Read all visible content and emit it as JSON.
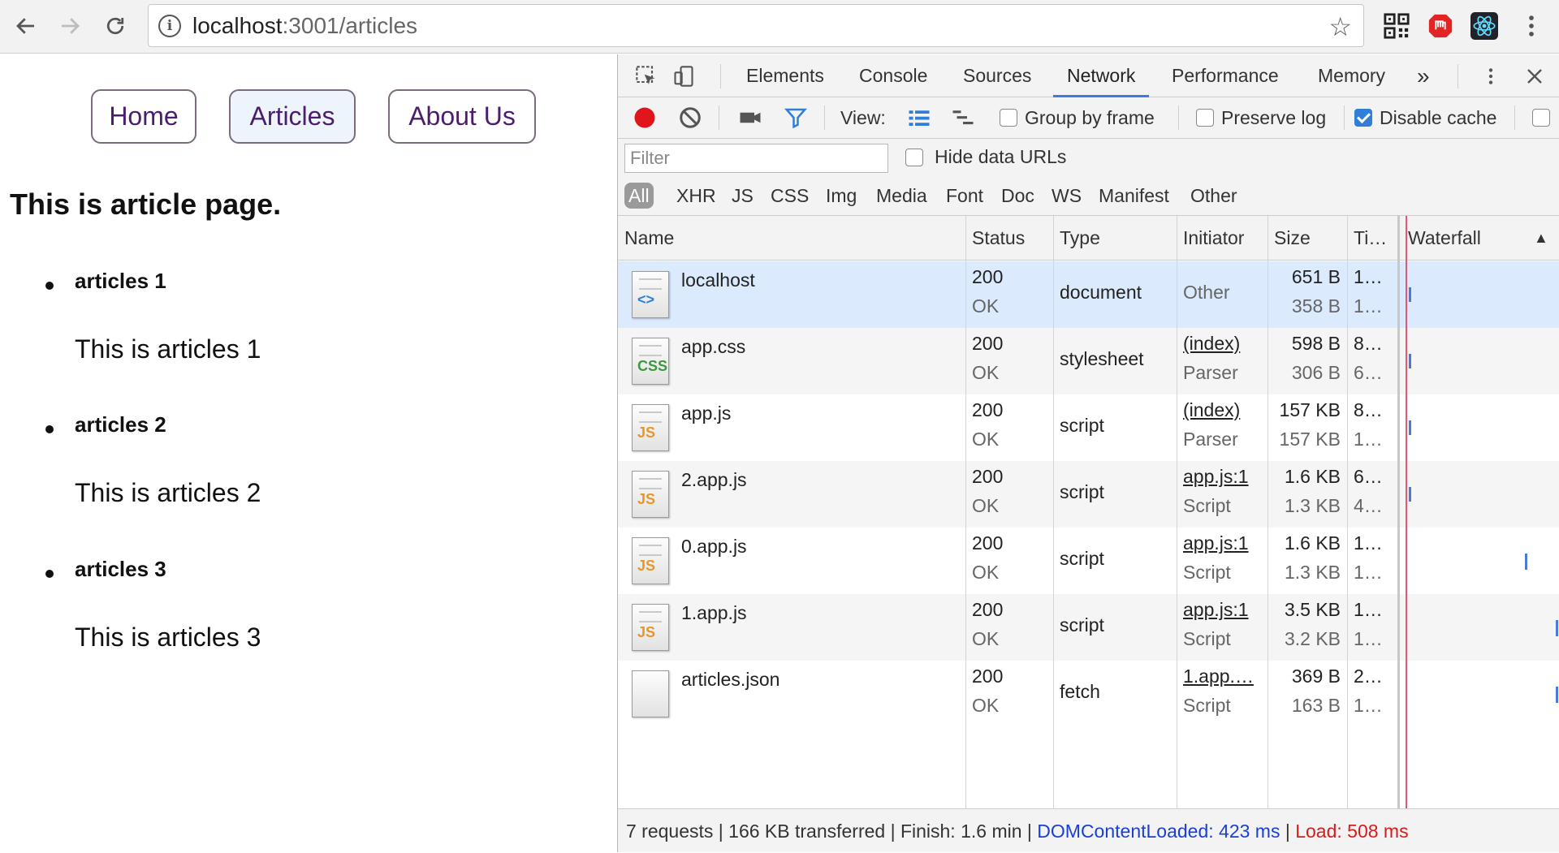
{
  "browser": {
    "url_host": "localhost",
    "url_path": ":3001/articles"
  },
  "page": {
    "nav": [
      {
        "label": "Home"
      },
      {
        "label": "Articles"
      },
      {
        "label": "About Us"
      }
    ],
    "title": "This is article page.",
    "articles": [
      {
        "title": "articles 1",
        "body": "This is articles 1"
      },
      {
        "title": "articles 2",
        "body": "This is articles 2"
      },
      {
        "title": "articles 3",
        "body": "This is articles 3"
      }
    ]
  },
  "devtools": {
    "tabs": [
      "Elements",
      "Console",
      "Sources",
      "Network",
      "Performance",
      "Memory"
    ],
    "active_tab": "Network",
    "more": "»",
    "toolbar": {
      "view_label": "View:",
      "group_by_frame": "Group by frame",
      "preserve_log": "Preserve log",
      "disable_cache": "Disable cache"
    },
    "filter_placeholder": "Filter",
    "hide_data_urls": "Hide data URLs",
    "type_filters": [
      "All",
      "XHR",
      "JS",
      "CSS",
      "Img",
      "Media",
      "Font",
      "Doc",
      "WS",
      "Manifest",
      "Other"
    ],
    "columns": {
      "name": "Name",
      "status": "Status",
      "type": "Type",
      "initiator": "Initiator",
      "size": "Size",
      "time": "Ti…",
      "waterfall": "Waterfall"
    },
    "requests": [
      {
        "name": "localhost",
        "icon": "<>",
        "status": "200",
        "status_text": "OK",
        "type": "document",
        "initiator": "Other",
        "initiator_sub": "",
        "size": "651 B",
        "size_sub": "358 B",
        "time": "1…",
        "time_sub": "1…"
      },
      {
        "name": "app.css",
        "icon": "CSS",
        "status": "200",
        "status_text": "OK",
        "type": "stylesheet",
        "initiator": "(index)",
        "initiator_sub": "Parser",
        "size": "598 B",
        "size_sub": "306 B",
        "time": "8…",
        "time_sub": "6…"
      },
      {
        "name": "app.js",
        "icon": "JS",
        "status": "200",
        "status_text": "OK",
        "type": "script",
        "initiator": "(index)",
        "initiator_sub": "Parser",
        "size": "157 KB",
        "size_sub": "157 KB",
        "time": "8…",
        "time_sub": "1…"
      },
      {
        "name": "2.app.js",
        "icon": "JS",
        "status": "200",
        "status_text": "OK",
        "type": "script",
        "initiator": "app.js:1",
        "initiator_sub": "Script",
        "size": "1.6 KB",
        "size_sub": "1.3 KB",
        "time": "6…",
        "time_sub": "4…"
      },
      {
        "name": "0.app.js",
        "icon": "JS",
        "status": "200",
        "status_text": "OK",
        "type": "script",
        "initiator": "app.js:1",
        "initiator_sub": "Script",
        "size": "1.6 KB",
        "size_sub": "1.3 KB",
        "time": "1…",
        "time_sub": "1…"
      },
      {
        "name": "1.app.js",
        "icon": "JS",
        "status": "200",
        "status_text": "OK",
        "type": "script",
        "initiator": "app.js:1",
        "initiator_sub": "Script",
        "size": "3.5 KB",
        "size_sub": "3.2 KB",
        "time": "1…",
        "time_sub": "1…"
      },
      {
        "name": "articles.json",
        "icon": "",
        "status": "200",
        "status_text": "OK",
        "type": "fetch",
        "initiator": "1.app.…",
        "initiator_sub": "Script",
        "size": "369 B",
        "size_sub": "163 B",
        "time": "2…",
        "time_sub": "1…"
      }
    ],
    "summary": {
      "main": "7 requests | 166 KB transferred | Finish: 1.6 min | ",
      "dcl": "DOMContentLoaded: 423 ms",
      "sep": " | ",
      "load": "Load: 508 ms"
    }
  },
  "colors": {
    "accent_blue": "#3b7ce3",
    "record_red": "#e0161c",
    "dcl_blue": "#1a3fd6",
    "load_red": "#d81b1b",
    "link_purple": "#4b1d6e"
  }
}
